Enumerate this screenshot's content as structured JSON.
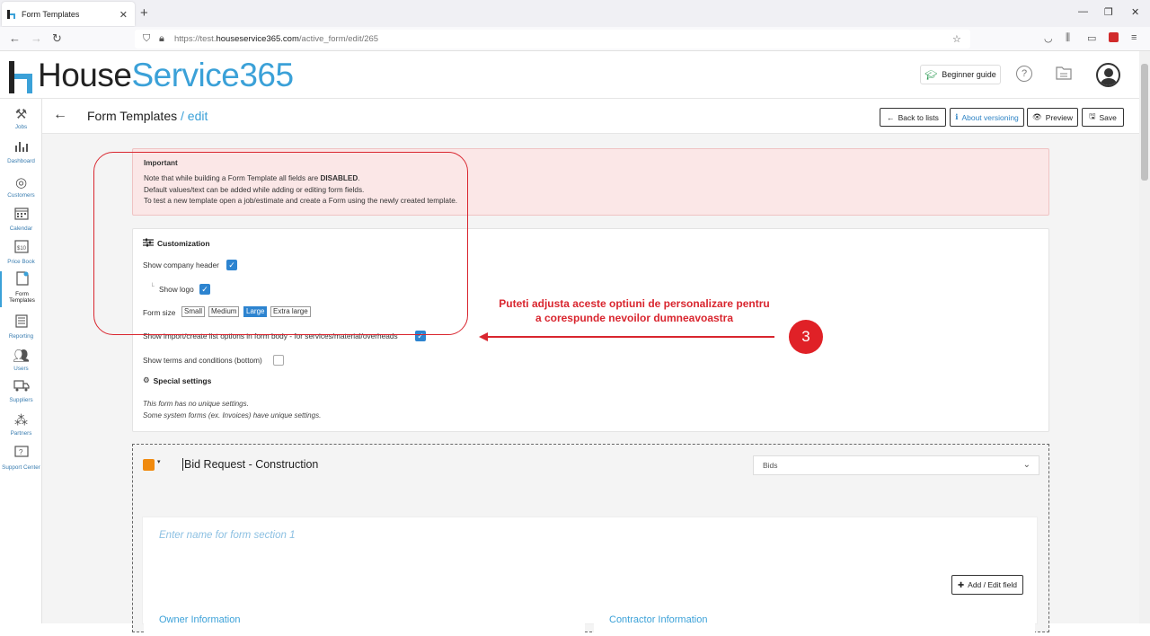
{
  "browser": {
    "tab_title": "Form Templates",
    "tab_close": "✕",
    "new_tab": "+",
    "url_prefix": "https://test.",
    "url_domain": "houseservice365.com",
    "url_path": "/active_form/edit/265",
    "window_minimize": "—",
    "window_restore": "❐",
    "window_close": "✕"
  },
  "app": {
    "logo_part1": "House",
    "logo_part2": "Service365",
    "beginner_guide": "Beginner guide",
    "help_glyph": "?"
  },
  "sidebar": {
    "items": [
      {
        "label": "Jobs",
        "icon": "tools-icon"
      },
      {
        "label": "Dashboard",
        "icon": "chart-icon"
      },
      {
        "label": "Customers",
        "icon": "target-icon"
      },
      {
        "label": "Calendar",
        "icon": "calendar-icon"
      },
      {
        "label": "Price Book",
        "icon": "price-tag-icon"
      },
      {
        "label": "Form Templates",
        "icon": "form-icon"
      },
      {
        "label": "Reporting",
        "icon": "report-icon"
      },
      {
        "label": "Users",
        "icon": "users-icon"
      },
      {
        "label": "Suppliers",
        "icon": "truck-icon"
      },
      {
        "label": "Partners",
        "icon": "partners-icon"
      },
      {
        "label": "Support Center",
        "icon": "support-icon"
      }
    ]
  },
  "page": {
    "title": "Form Templates",
    "title_suffix": " / edit",
    "buttons": {
      "back": "Back to lists",
      "versioning": "About versioning",
      "preview": "Preview",
      "save": "Save"
    }
  },
  "alert": {
    "title": "Important",
    "line1_prefix": "Note that while building a Form Template all fields are ",
    "line1_bold": "DISABLED",
    "line1_suffix": ".",
    "line2": "Default values/text can be added while adding or editing form fields.",
    "line3": "To test a new template open a job/estimate and create a Form using the newly created template."
  },
  "customization": {
    "title": "Customization",
    "show_company_header": "Show company header",
    "show_company_header_checked": true,
    "show_logo": "Show logo",
    "show_logo_checked": true,
    "form_size_label": "Form size",
    "form_sizes": [
      "Small",
      "Medium",
      "Large",
      "Extra large"
    ],
    "form_size_selected": "Large",
    "show_import": "Show import/create list options in form body - for services/material/overheads",
    "show_import_checked": true,
    "show_terms": "Show terms and conditions (bottom)",
    "show_terms_checked": false,
    "special_title": "Special settings",
    "special_note1": "This form has no unique settings.",
    "special_note2": "Some system forms (ex. Invoices) have unique settings."
  },
  "annotation": {
    "line1": "Puteti adjusta aceste optiuni de personalizare pentru",
    "line2": "a corespunde nevoilor dumneavoastra",
    "badge": "3",
    "color": "#d9262f"
  },
  "form": {
    "color": "#f08a0e",
    "name": "Bid Request - Construction",
    "category": "Bids",
    "section_placeholder": "Enter name for form section 1",
    "add_field": "Add / Edit field",
    "owner_info": "Owner Information",
    "contractor_info": "Contractor Information"
  }
}
